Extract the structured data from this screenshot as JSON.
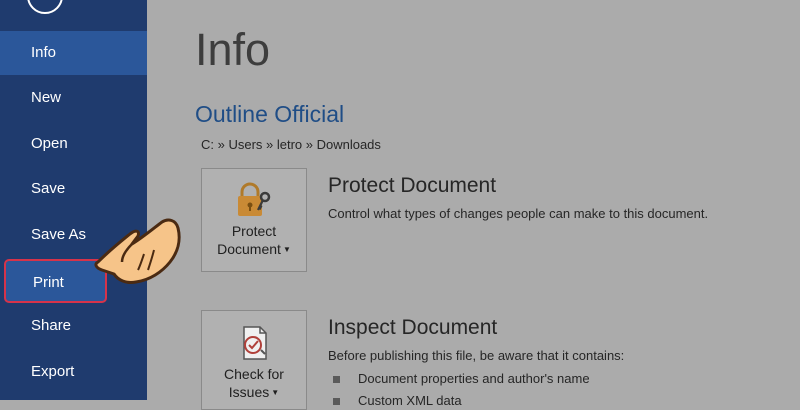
{
  "sidebar": {
    "items": [
      {
        "label": "Info",
        "state": "active"
      },
      {
        "label": "New"
      },
      {
        "label": "Open"
      },
      {
        "label": "Save"
      },
      {
        "label": "Save As"
      },
      {
        "label": "Print",
        "state": "highlighted"
      },
      {
        "label": "Share"
      },
      {
        "label": "Export"
      }
    ]
  },
  "main": {
    "title": "Info",
    "document_name": "Outline Official",
    "document_path": "C: » Users » letro » Downloads",
    "protect": {
      "button_line1": "Protect",
      "button_line2": "Document",
      "heading": "Protect Document",
      "description": "Control what types of changes people can make to this document."
    },
    "inspect": {
      "button_line1": "Check for",
      "button_line2": "Issues",
      "heading": "Inspect Document",
      "description": "Before publishing this file, be aware that it contains:",
      "bullets": [
        "Document properties and author's name",
        "Custom XML data"
      ]
    }
  },
  "colors": {
    "sidebar_bg": "#1f3b6e",
    "sidebar_active": "#2b579a",
    "highlight_border": "#d6334a",
    "content_bg": "#ababab",
    "doc_title": "#1f4d86"
  }
}
